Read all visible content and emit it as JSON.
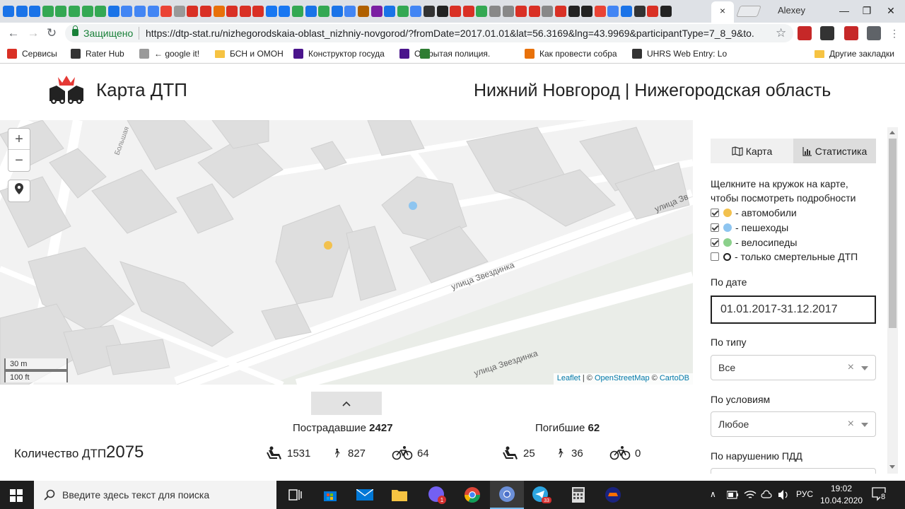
{
  "browser": {
    "user": "Alexey",
    "close_tab": "×",
    "window_controls": {
      "minimize": "—",
      "maximize": "❐",
      "close": "✕"
    },
    "secure_label": "Защищено",
    "url": "https://dtp-stat.ru/nizhegorodskaia-oblast_nizhniy-novgorod/?fromDate=2017.01.01&lat=56.3169&lng=43.9969&participantType=7_8_9&to...",
    "nav": {
      "back": "←",
      "forward": "→",
      "reload": "↻"
    },
    "star": "☆",
    "tab_favicon_colors": [
      "#1a73e8",
      "#1a73e8",
      "#1a73e8",
      "#34a853",
      "#34a853",
      "#34a853",
      "#34a853",
      "#34a853",
      "#1a73e8",
      "#4285f4",
      "#4285f4",
      "#4285f4",
      "#ea4335",
      "#999999",
      "#d93025",
      "#d93025",
      "#e8710a",
      "#d93025",
      "#d93025",
      "#d93025",
      "#1877f2",
      "#1877f2",
      "#34a853",
      "#1a73e8",
      "#34a853",
      "#1a73e8",
      "#4285f4",
      "#b06000",
      "#7b1fa2",
      "#1a73e8",
      "#34a853",
      "#4285f4",
      "#333333",
      "#222222",
      "#d93025",
      "#d93025",
      "#34a853",
      "#888888",
      "#888888",
      "#d93025",
      "#d93025",
      "#888888",
      "#d93025",
      "#222222",
      "#222222",
      "#ea4335",
      "#4285f4",
      "#1a73e8",
      "#333333",
      "#d93025",
      "#222222"
    ],
    "extensions": [
      {
        "name": "nrt-extension",
        "color": "#c62828"
      },
      {
        "name": "spy-extension",
        "color": "#333333"
      },
      {
        "name": "yandex-extension",
        "color": "#c62828"
      },
      {
        "name": "translate-extension",
        "color": "#5f6368"
      }
    ],
    "bookmarks": [
      {
        "label": "Сервисы",
        "color": "#d93025"
      },
      {
        "label": "Rater Hub",
        "color": "#333333"
      },
      {
        "label": "← google it!",
        "color": "#999999"
      },
      {
        "label": "БСН и ОМОН",
        "color": "#f6c342"
      },
      {
        "label": "Конструктор госуда",
        "color": "#4a148c"
      },
      {
        "label": "Открытая полиция.",
        "color": "#4a148c"
      },
      {
        "label": "Как провести собра",
        "color": "#2e7d32"
      },
      {
        "label": "UHRS Web Entry: Lo",
        "color": "#e8710a"
      },
      {
        "label": "Другие закладки",
        "color": "#f6c342"
      }
    ]
  },
  "site": {
    "title": "Карта ДТП",
    "region": "Нижний Новгород | Нижегородская область",
    "logo_color": "#e53935"
  },
  "map": {
    "zoom_in": "+",
    "zoom_out": "−",
    "locate": "⌖",
    "scale_metric": "30 m",
    "scale_imperial": "100 ft",
    "street_labels": [
      "улица Звездинка",
      "улица Звездинка",
      "улица Зв",
      "Большая"
    ],
    "attribution": {
      "leaflet": "Leaflet",
      "sep": " | © ",
      "osm": "OpenStreetMap",
      "sep2": " © ",
      "carto": "CartoDB"
    },
    "markers": [
      {
        "type": "автомобили",
        "color": "#f2c14e"
      },
      {
        "type": "пешеходы",
        "color": "#8ec5f0"
      }
    ]
  },
  "stats": {
    "collapse": "⌃",
    "count_label": "Количество ДТП",
    "count_value": "2075",
    "injured": {
      "label": "Пострадавшие",
      "total": "2427",
      "car": "1531",
      "pedestrian": "827",
      "bicycle": "64"
    },
    "killed": {
      "label": "Погибшие",
      "total": "62",
      "car": "25",
      "pedestrian": "36",
      "bicycle": "0"
    }
  },
  "sidebar": {
    "tab_map": "Карта",
    "tab_stats": "Статистика",
    "hint": "Щелкните на кружок на карте, чтобы посмотреть подробности",
    "legend": [
      {
        "label": "- автомобили",
        "checked": true,
        "color": "#f2c14e"
      },
      {
        "label": "- пешеходы",
        "checked": true,
        "color": "#8ec5f0"
      },
      {
        "label": "- велосипеды",
        "checked": true,
        "color": "#8bd08b"
      },
      {
        "label": "- только смертельные ДТП",
        "checked": false,
        "color": "ring"
      }
    ],
    "date_label": "По дате",
    "date_value": "01.01.2017-31.12.2017",
    "type_label": "По типу",
    "type_value": "Все",
    "conditions_label": "По условиям",
    "conditions_value": "Любое",
    "violation_label": "По нарушению ПДД",
    "clear": "×"
  },
  "taskbar": {
    "search_placeholder": "Введите здесь текст для поиска",
    "lang": "РУС",
    "time": "19:02",
    "date": "10.04.2020",
    "notifications": "8",
    "viber_badge": "1",
    "telegram_badge": "33",
    "tray_up": "∧"
  }
}
